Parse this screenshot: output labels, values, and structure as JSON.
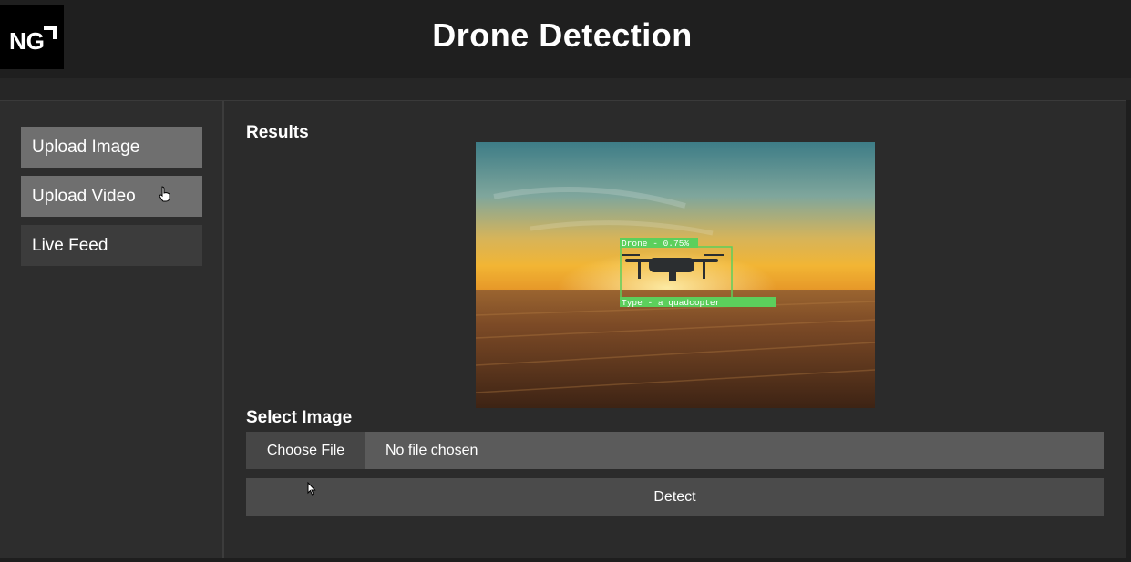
{
  "header": {
    "logo_text": "NG",
    "title": "Drone Detection"
  },
  "sidebar": {
    "items": [
      {
        "label": "Upload Image",
        "state": "active"
      },
      {
        "label": "Upload Video",
        "state": "active"
      },
      {
        "label": "Live Feed",
        "state": "inactive"
      }
    ]
  },
  "results": {
    "title": "Results",
    "detection": {
      "label": "Drone - 0.75%",
      "type_label": "Type - a quadcopter",
      "box_color": "#5ccf5c"
    }
  },
  "select": {
    "title": "Select Image",
    "choose_label": "Choose File",
    "file_status": "No file chosen",
    "detect_label": "Detect"
  },
  "colors": {
    "background": "#1e1e1e",
    "panel": "#2b2b2b",
    "active_button": "#6f6f6f",
    "inactive_button": "#3c3c3c",
    "detection_green": "#5ccf5c"
  }
}
